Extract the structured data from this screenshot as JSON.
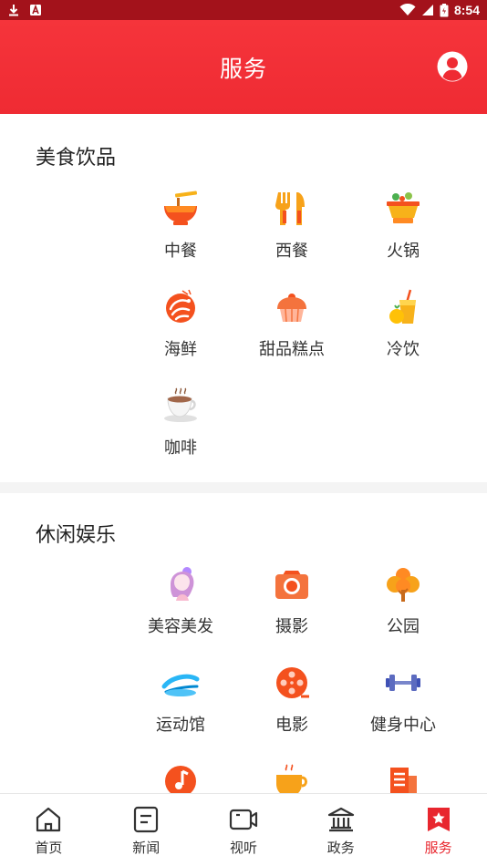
{
  "status_bar": {
    "time": "8:54",
    "icons": [
      "download-icon",
      "a-badge-icon",
      "wifi-icon",
      "signal-icon",
      "battery-icon"
    ]
  },
  "header": {
    "title": "服务",
    "user_icon": "user-circle-icon"
  },
  "accent_color": "#ef2b33",
  "sections": [
    {
      "title": "美食饮品",
      "items": [
        {
          "label": "中餐",
          "icon": "noodle-bowl-icon"
        },
        {
          "label": "西餐",
          "icon": "fork-knife-icon"
        },
        {
          "label": "火锅",
          "icon": "hotpot-icon"
        },
        {
          "label": "海鲜",
          "icon": "shrimp-icon"
        },
        {
          "label": "甜品糕点",
          "icon": "cupcake-icon"
        },
        {
          "label": "冷饮",
          "icon": "cold-drink-icon"
        },
        {
          "label": "咖啡",
          "icon": "coffee-cup-icon"
        }
      ]
    },
    {
      "title": "休闲娱乐",
      "items": [
        {
          "label": "美容美发",
          "icon": "beauty-woman-icon"
        },
        {
          "label": "摄影",
          "icon": "camera-icon"
        },
        {
          "label": "公园",
          "icon": "tree-icon"
        },
        {
          "label": "运动馆",
          "icon": "stadium-icon"
        },
        {
          "label": "电影",
          "icon": "film-reel-icon"
        },
        {
          "label": "健身中心",
          "icon": "dumbbell-icon"
        },
        {
          "label": "",
          "icon": "music-note-icon"
        },
        {
          "label": "",
          "icon": "tea-cup-icon"
        },
        {
          "label": "",
          "icon": "book-icon"
        }
      ]
    }
  ],
  "tabbar": [
    {
      "label": "首页",
      "icon": "home-icon",
      "active": false
    },
    {
      "label": "新闻",
      "icon": "news-icon",
      "active": false
    },
    {
      "label": "视听",
      "icon": "video-icon",
      "active": false
    },
    {
      "label": "政务",
      "icon": "government-icon",
      "active": false
    },
    {
      "label": "服务",
      "icon": "service-star-icon",
      "active": true
    }
  ]
}
